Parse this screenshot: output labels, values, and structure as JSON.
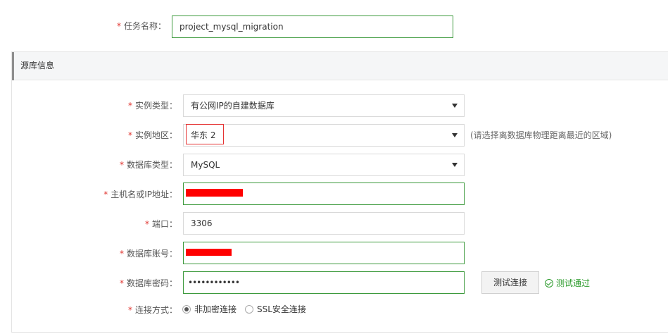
{
  "task": {
    "label": "任务名称：",
    "value": "project_mysql_migration"
  },
  "section": {
    "title": "源库信息"
  },
  "fields": {
    "instance_type": {
      "label": "实例类型：",
      "value": "有公网IP的自建数据库"
    },
    "instance_region": {
      "label": "实例地区：",
      "value": "华东 2",
      "hint": "(请选择离数据库物理距离最近的区域)"
    },
    "db_type": {
      "label": "数据库类型：",
      "value": "MySQL"
    },
    "host": {
      "label": "主机名或IP地址："
    },
    "port": {
      "label": "端口：",
      "value": "3306"
    },
    "account": {
      "label": "数据库账号："
    },
    "password": {
      "label": "数据库密码：",
      "value": "••••••••••••"
    }
  },
  "test": {
    "button_label": "测试连接",
    "status_text": "测试通过"
  },
  "connection": {
    "label": "连接方式：",
    "options": [
      {
        "label": "非加密连接",
        "selected": true
      },
      {
        "label": "SSL安全连接",
        "selected": false
      }
    ]
  },
  "required_mark": "*",
  "colors": {
    "required": "#e0342f",
    "valid_border": "#3d9a3d",
    "success_text": "#2a9a2a",
    "redaction": "#ff0000"
  },
  "icons": {
    "dropdown": "chevron-down-icon",
    "success": "check-circle-icon"
  }
}
